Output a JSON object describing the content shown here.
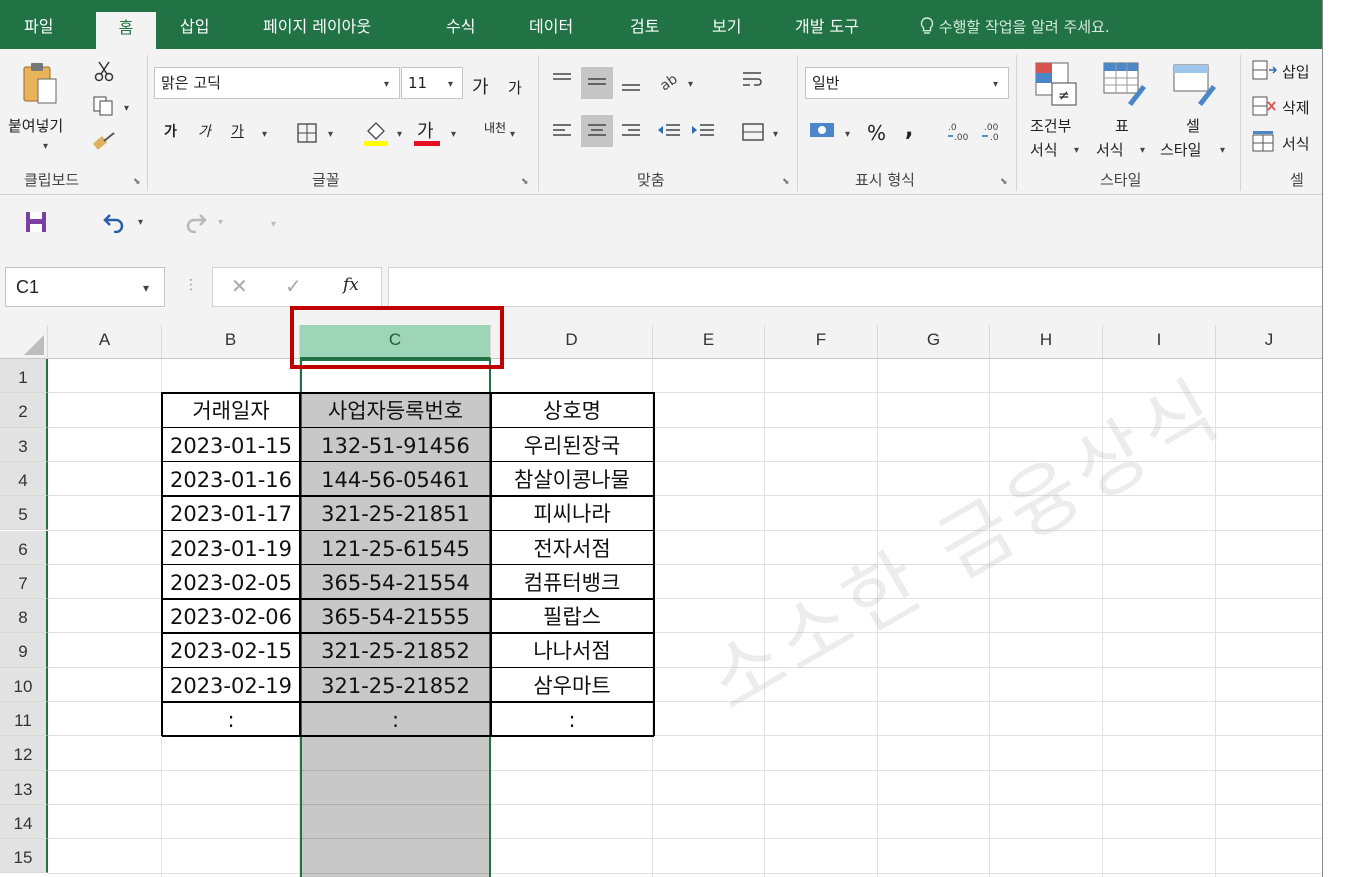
{
  "tabs": [
    "파일",
    "홈",
    "삽입",
    "페이지 레이아웃",
    "수식",
    "데이터",
    "검토",
    "보기",
    "개발 도구"
  ],
  "active_tab": "홈",
  "tell_me": "수행할 작업을 알려 주세요.",
  "ribbon": {
    "clipboard": {
      "paste": "붙여넣기",
      "label": "클립보드"
    },
    "font": {
      "name": "맑은 고딕",
      "size": "11",
      "grow": "가",
      "shrink": "가",
      "bold": "가",
      "italic": "가",
      "underline": "가",
      "font_color_glyph": "가",
      "phonetic": "내천",
      "label": "글꼴"
    },
    "alignment": {
      "label": "맞춤"
    },
    "number": {
      "format": "일반",
      "percent": "%",
      "comma": ",",
      "label": "표시 형식"
    },
    "styles": {
      "conditional": [
        "조건부",
        "서식"
      ],
      "table": [
        "표",
        "서식"
      ],
      "cell": [
        "셀",
        "스타일"
      ],
      "label": "스타일"
    },
    "cells": {
      "insert": "삽입",
      "delete": "삭제",
      "format": "서식",
      "label": "셀"
    }
  },
  "formula_bar": {
    "name_box": "C1",
    "fx": "fx",
    "value": ""
  },
  "columns": [
    "A",
    "B",
    "C",
    "D",
    "E",
    "F",
    "G",
    "H",
    "I",
    "J"
  ],
  "selected_column": "C",
  "rows": [
    "1",
    "2",
    "3",
    "4",
    "5",
    "6",
    "7",
    "8",
    "9",
    "10",
    "11",
    "12",
    "13",
    "14",
    "15"
  ],
  "table": {
    "headers": [
      "거래일자",
      "사업자등록번호",
      "상호명"
    ],
    "rows": [
      [
        "2023-01-15",
        "132-51-91456",
        "우리된장국"
      ],
      [
        "2023-01-16",
        "144-56-05461",
        "참살이콩나물"
      ],
      [
        "2023-01-17",
        "321-25-21851",
        "피씨나라"
      ],
      [
        "2023-01-19",
        "121-25-61545",
        "전자서점"
      ],
      [
        "2023-02-05",
        "365-54-21554",
        "컴퓨터뱅크"
      ],
      [
        "2023-02-06",
        "365-54-21555",
        "필랍스"
      ],
      [
        "2023-02-15",
        "321-25-21852",
        "나나서점"
      ],
      [
        "2023-02-19",
        "321-25-21852",
        "삼우마트"
      ],
      [
        ":",
        ":",
        ":"
      ]
    ]
  },
  "watermark": "소소한 금융상식",
  "colors": {
    "excel_green": "#217346",
    "selection_fill": "#c8c8c8",
    "highlight_border": "#c00000"
  }
}
